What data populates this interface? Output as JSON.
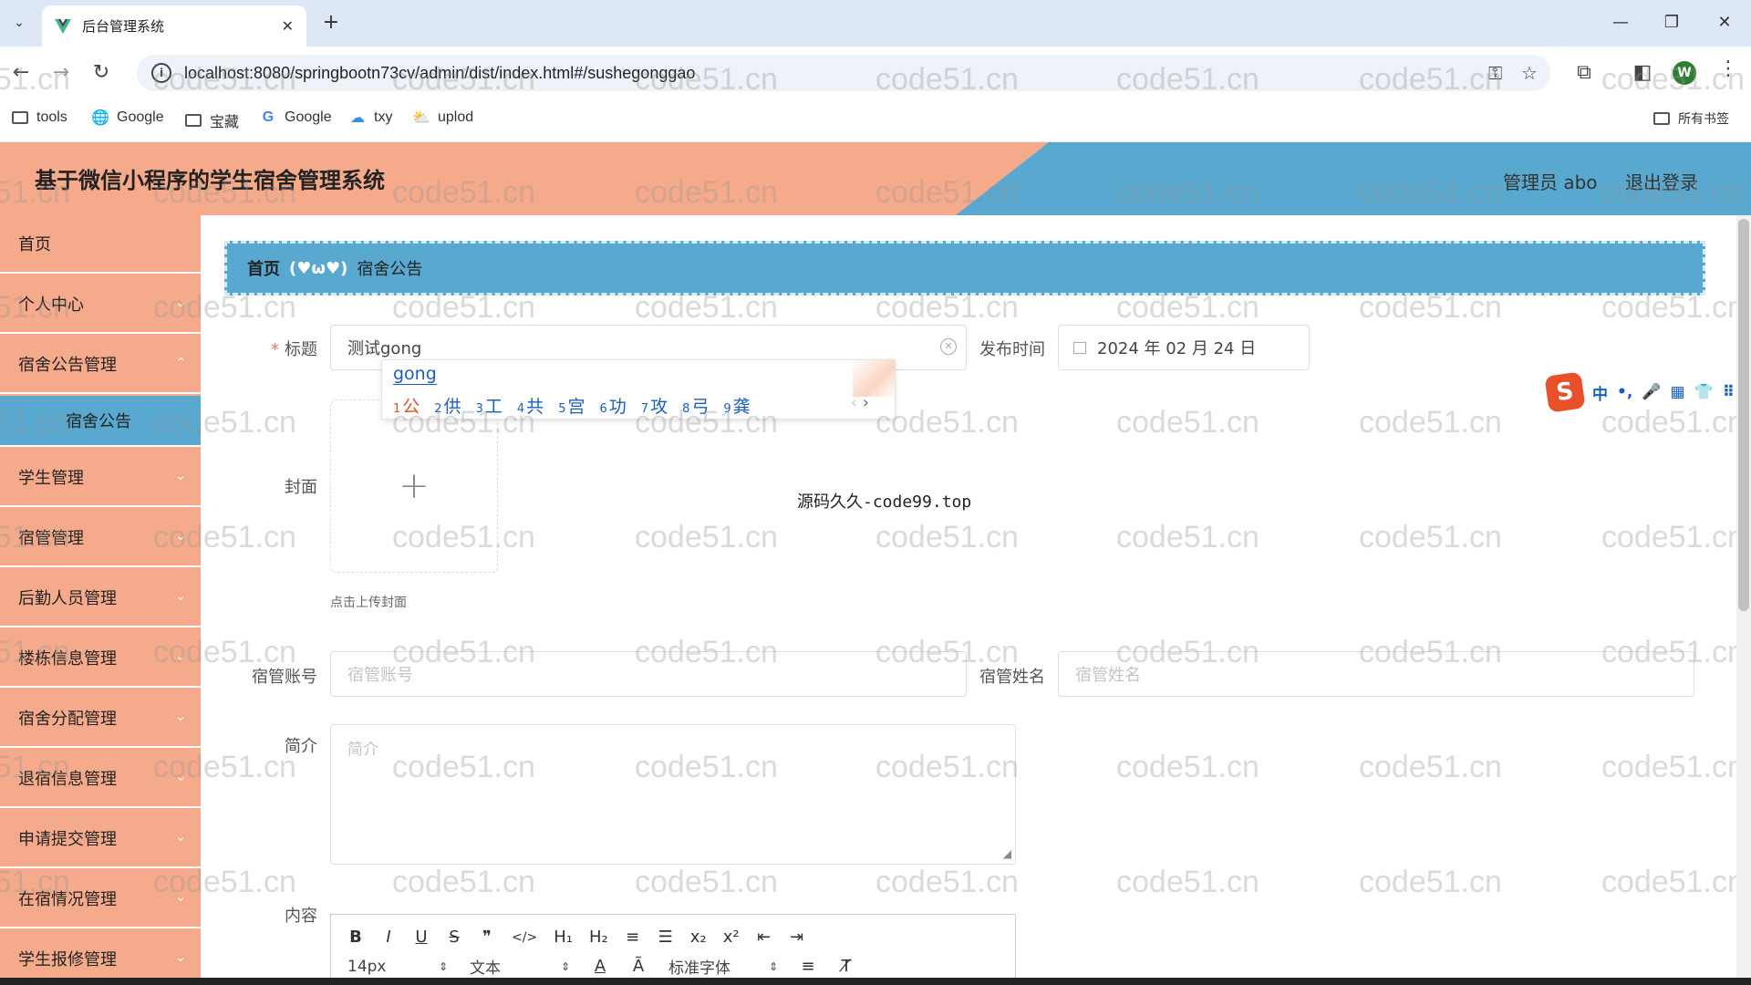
{
  "browser": {
    "tab_title": "后台管理系统",
    "url": "localhost:8080/springbootn73cv/admin/dist/index.html#/sushegonggao",
    "profile_initial": "W",
    "bookmarks": [
      "tools",
      "Google",
      "宝藏",
      "Google",
      "txy",
      "uplod"
    ],
    "all_bookmarks": "所有书签"
  },
  "header": {
    "title": "基于微信小程序的学生宿舍管理系统",
    "admin": "管理员 abo",
    "logout": "退出登录"
  },
  "sidebar": {
    "items": [
      {
        "label": "首页"
      },
      {
        "label": "个人中心"
      },
      {
        "label": "宿舍公告管理"
      },
      {
        "label": "宿舍公告"
      },
      {
        "label": "学生管理"
      },
      {
        "label": "宿管管理"
      },
      {
        "label": "后勤人员管理"
      },
      {
        "label": "楼栋信息管理"
      },
      {
        "label": "宿舍分配管理"
      },
      {
        "label": "退宿信息管理"
      },
      {
        "label": "申请提交管理"
      },
      {
        "label": "在宿情况管理"
      },
      {
        "label": "学生报修管理"
      }
    ]
  },
  "breadcrumb": {
    "home": "首页",
    "separator": "(♥ω♥)",
    "current": "宿舍公告"
  },
  "form": {
    "title_label": "标题",
    "title_value": "测试gong",
    "publish_label": "发布时间",
    "publish_value": "2024 年 02 月 24 日",
    "cover_label": "封面",
    "upload_plus": "+",
    "upload_hint": "点击上传封面",
    "account_label": "宿管账号",
    "account_placeholder": "宿管账号",
    "name_label": "宿管姓名",
    "name_placeholder": "宿管姓名",
    "intro_label": "简介",
    "intro_placeholder": "简介",
    "content_label": "内容"
  },
  "editor": {
    "row1": [
      "B",
      "I",
      "U",
      "S",
      "❞",
      "</>",
      "H₁",
      "H₂",
      "≡",
      "☰",
      "x₂",
      "x²",
      "⇤",
      "⇥"
    ],
    "font_size": "14px",
    "text_type": "文本",
    "font_family": "标准字体"
  },
  "ime": {
    "composition": "gong",
    "candidates": [
      "公",
      "供",
      "工",
      "共",
      "宫",
      "功",
      "攻",
      "弓",
      "龚"
    ],
    "status": [
      "中",
      "•,",
      "🎤",
      "▦",
      "👕",
      "⠿"
    ]
  },
  "watermark": {
    "center": "源码久久-code99.top",
    "repeat": "code51.cn"
  }
}
